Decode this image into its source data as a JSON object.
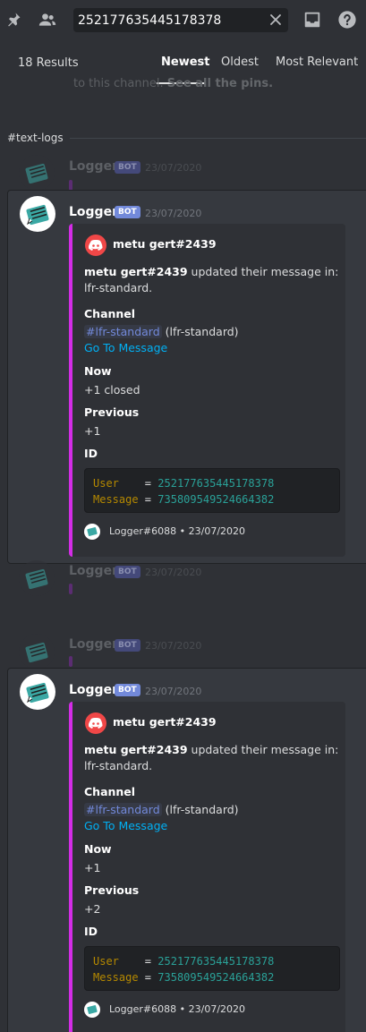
{
  "search": {
    "query": "252177635445178378"
  },
  "results_header": {
    "count": "18 Results",
    "sort_options": [
      "Newest",
      "Oldest",
      "Most Relevant"
    ],
    "active_sort": "Newest"
  },
  "ghost_text": {
    "prefix": "to this channel.",
    "link": "See all the pins."
  },
  "channel": "#text-logs",
  "context_messages": [
    {
      "author": "Logger",
      "tag": "BOT",
      "timestamp": "23/07/2020"
    },
    {
      "author": "Logger",
      "tag": "BOT",
      "timestamp": "23/07/2020"
    },
    {
      "author": "Logger",
      "tag": "BOT",
      "timestamp": "23/07/2020"
    }
  ],
  "results": [
    {
      "author": "Logger",
      "tag": "BOT",
      "timestamp": "23/07/2020",
      "embed": {
        "author": "metu gert#2439",
        "description_user": "metu gert#2439",
        "description_rest": " updated their message in: lfr-standard.",
        "fields": {
          "channel_name": "Channel",
          "channel_mention": "#lfr-standard",
          "channel_suffix": " (lfr-standard)",
          "goto_link": "Go To Message",
          "now_name": "Now",
          "now_value": "+1 closed",
          "previous_name": "Previous",
          "previous_value": "+1",
          "id_name": "ID"
        },
        "code": {
          "user_key": "User",
          "user_val": "252177635445178378",
          "message_key": "Message",
          "message_val": "735809549524664382"
        },
        "footer": "Logger#6088 • 23/07/2020"
      }
    },
    {
      "author": "Logger",
      "tag": "BOT",
      "timestamp": "23/07/2020",
      "embed": {
        "author": "metu gert#2439",
        "description_user": "metu gert#2439",
        "description_rest": " updated their message in: lfr-standard.",
        "fields": {
          "channel_name": "Channel",
          "channel_mention": "#lfr-standard",
          "channel_suffix": " (lfr-standard)",
          "goto_link": "Go To Message",
          "now_name": "Now",
          "now_value": "+1",
          "previous_name": "Previous",
          "previous_value": "+2",
          "id_name": "ID"
        },
        "code": {
          "user_key": "User",
          "user_val": "252177635445178378",
          "message_key": "Message",
          "message_val": "735809549524664382"
        },
        "footer": "Logger#6088 • 23/07/2020"
      }
    }
  ],
  "icons": {
    "pin": "pin-icon",
    "members": "members-icon",
    "clear": "close-icon",
    "inbox": "inbox-icon",
    "help": "help-icon"
  },
  "colors": {
    "embed_accent": "#d32ce6",
    "bot_tag": "#7289da",
    "link": "#00b0f4",
    "code_key": "#b58900",
    "code_value": "#2aa198"
  }
}
